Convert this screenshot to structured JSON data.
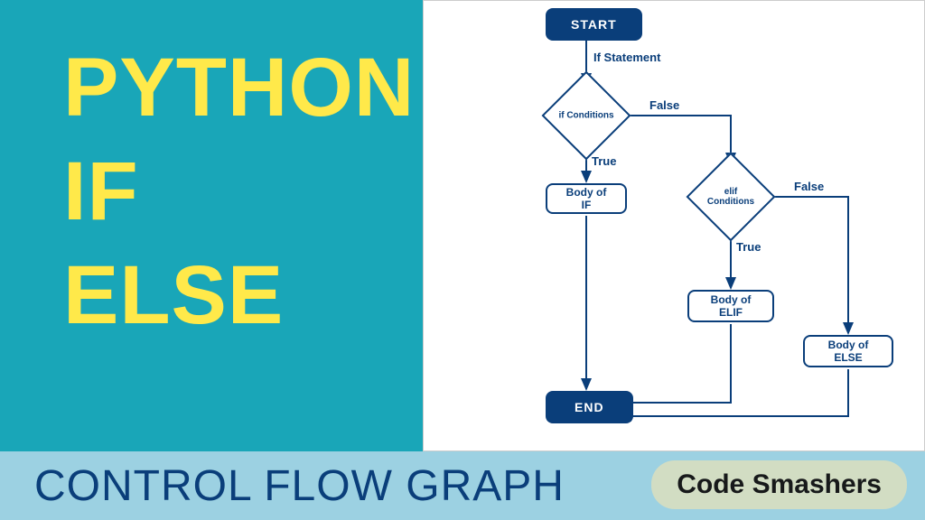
{
  "title": {
    "line1": "PYTHON",
    "line2": "IF",
    "line3": "ELSE"
  },
  "footer": {
    "heading": "CONTROL FLOW GRAPH",
    "brand": "Code Smashers"
  },
  "flow": {
    "start": "START",
    "end": "END",
    "if_statement_label": "If Statement",
    "if_condition": "if Conditions",
    "elif_condition": "elif Conditions",
    "body_if": "Body of IF",
    "body_elif": "Body of ELIF",
    "body_else": "Body of ELSE",
    "true_label": "True",
    "false_label": "False"
  },
  "colors": {
    "teal": "#19a6b8",
    "yellow": "#ffe94a",
    "navy": "#0a3e7a",
    "lightblue": "#9cd1e2",
    "pill": "#d2ddc3"
  }
}
